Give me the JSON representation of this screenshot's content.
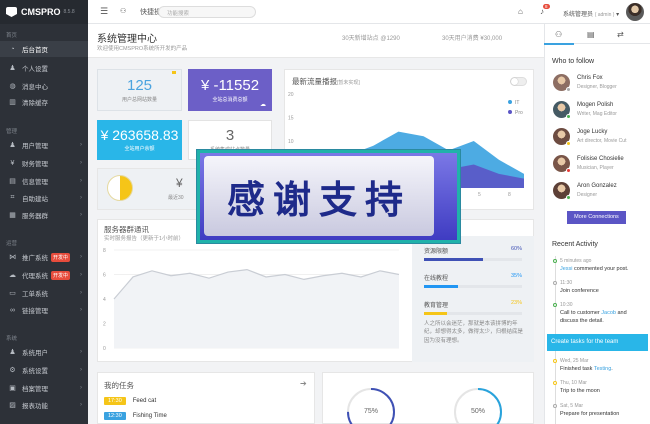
{
  "logo": {
    "name": "CMSPRO",
    "version": "8.5.8"
  },
  "sidebar": {
    "sections": [
      "首页",
      "管理",
      "运营",
      "系统"
    ],
    "items": [
      {
        "label": "后台首页",
        "icon": "gauge-icon",
        "active": true
      },
      {
        "label": "个人设置",
        "icon": "user-icon"
      },
      {
        "label": "消息中心",
        "icon": "globe-icon"
      },
      {
        "label": "清除缓存",
        "icon": "trash-icon"
      },
      {
        "label": "用户管理",
        "icon": "users-icon"
      },
      {
        "label": "财务管理",
        "icon": "money-icon"
      },
      {
        "label": "信息管理",
        "icon": "file-icon"
      },
      {
        "label": "自助建站",
        "icon": "sitemap-icon"
      },
      {
        "label": "服务器群",
        "icon": "server-icon"
      },
      {
        "label": "推广系统",
        "icon": "share-icon",
        "badge": "开发中"
      },
      {
        "label": "代理系统",
        "icon": "cloud-icon",
        "badge": "开发中"
      },
      {
        "label": "工单系统",
        "icon": "ticket-icon"
      },
      {
        "label": "链接管理",
        "icon": "link-icon"
      },
      {
        "label": "系统用户",
        "icon": "user-shield-icon"
      },
      {
        "label": "系统设置",
        "icon": "cog-icon"
      },
      {
        "label": "档案管理",
        "icon": "archive-icon"
      },
      {
        "label": "报表功能",
        "icon": "chart-icon"
      }
    ]
  },
  "topbar": {
    "quick_ops": "快捷操作",
    "search_placeholder": "功能搜索",
    "notif_count": "8",
    "user": "系统管理员",
    "role": "admin"
  },
  "title": {
    "main": "系统管理中心",
    "sub": "欢迎使用CMSPRO系统所开发的产品",
    "stat1_label": "30天新增站点",
    "stat1_value": "@1290",
    "stat2_label": "30天用户消费",
    "stat2_value": "¥30,000"
  },
  "stats": {
    "s1": {
      "value": "125",
      "label": "用户总网站数量"
    },
    "s2": {
      "value": "¥ -11552",
      "label": "全站总消费总额"
    },
    "s3": {
      "value": "¥ 263658.83",
      "label": "全站用户余额"
    },
    "s4": {
      "value": "3",
      "label": "系统集成站点数量"
    },
    "s5": {
      "value": "¥",
      "label": "最近30"
    }
  },
  "traffic": {
    "title": "最新流量播报",
    "hint": "[暂未实现]",
    "legend": [
      "IT",
      "Pro"
    ]
  },
  "server": {
    "title": "服务器群通讯",
    "sub": "实时服务报告（更新于1小时前）"
  },
  "chart_data": [
    {
      "type": "area",
      "title": "最新流量播报",
      "ytick_labels": [
        "20",
        "15",
        "10",
        "5",
        "0"
      ],
      "xtick_labels": [
        "2",
        "5",
        "8"
      ],
      "series": [
        {
          "name": "IT",
          "values": [
            4,
            5,
            7,
            9,
            12,
            11,
            8,
            10,
            6,
            3
          ]
        },
        {
          "name": "Pro",
          "values": [
            3,
            4,
            5,
            5,
            6,
            5,
            4,
            5,
            3,
            2
          ]
        }
      ]
    },
    {
      "type": "line",
      "title": "服务器群通讯",
      "ytick_labels": [
        "8",
        "6",
        "4",
        "2",
        "0"
      ],
      "values": [
        4,
        5.8,
        6.3,
        5.9,
        6.1,
        5.7,
        6.2,
        6.4,
        5.8,
        6.0,
        5.6,
        5.9,
        6.1,
        5.8,
        6.3,
        6.0
      ]
    }
  ],
  "progress": [
    {
      "label": "资源限额",
      "value": "60%",
      "fraction": 0.6,
      "color": "#3f51b5"
    },
    {
      "label": "在线教程",
      "value": "35%",
      "fraction": 0.35,
      "color": "#2196f3"
    },
    {
      "label": "教育管理",
      "value": "23%",
      "fraction": 0.23,
      "color": "#f5c518"
    }
  ],
  "progress_note": "人之所以会迷茫，那就是本该拼博的年纪，却想得太多，做得太少，归根结底是因为没有理想。",
  "tasks": {
    "title": "我的任务",
    "items": [
      {
        "time": "17:30",
        "text": "Feed cat",
        "color": "#f5c518"
      },
      {
        "time": "12:30",
        "text": "Fishing Time",
        "color": "#3aa2e0"
      }
    ]
  },
  "gauges": [
    {
      "value": "75%",
      "fraction": 0.75,
      "color": "#3f51b5"
    },
    {
      "value": "50%",
      "fraction": 0.5,
      "color": "#29a3dc"
    }
  ],
  "banner": "感谢支持",
  "who": {
    "title": "Who to follow",
    "people": [
      {
        "name": "Chris Fox",
        "role": "Designer, Blogger",
        "dot": "#aaa"
      },
      {
        "name": "Mogen Polish",
        "role": "Writer, Mag Editor",
        "dot": "#4caf50"
      },
      {
        "name": "Joge Lucky",
        "role": "Art director, Movie Cut",
        "dot": "#f5c518"
      },
      {
        "name": "Folisise Chosielie",
        "role": "Musician, Player",
        "dot": "#e53935"
      },
      {
        "name": "Aron Gonzalez",
        "role": "Designer",
        "dot": "#4caf50"
      }
    ],
    "more": "More Connections"
  },
  "activity": {
    "title": "Recent Activity",
    "items": [
      {
        "time": "5 minutes ago",
        "text_pre": "",
        "link": "Jessi",
        "text_post": " commented your post."
      },
      {
        "time": "11:30",
        "text_pre": "Join conference",
        "link": "",
        "text_post": ""
      },
      {
        "time": "10:30",
        "text_pre": "Call to customer ",
        "link": "Jacob",
        "text_post": " and discuss the detail."
      },
      {
        "time": "Wed, 25 Mar",
        "text_pre": "Finished task ",
        "link": "Testing",
        "text_post": "."
      },
      {
        "time": "Thu, 10 Mar",
        "text_pre": "Trip to the moon",
        "link": "",
        "text_post": ""
      },
      {
        "time": "Sat, 5 Mar",
        "text_pre": "Prepare for presentation",
        "link": "",
        "text_post": ""
      }
    ],
    "cta": "Create tasks for the team"
  }
}
